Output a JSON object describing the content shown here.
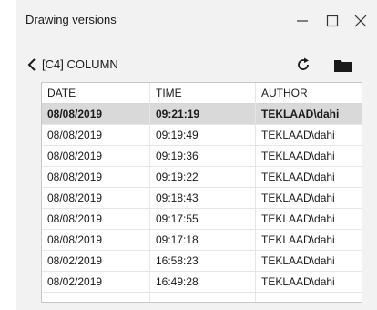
{
  "window": {
    "title": "Drawing versions"
  },
  "toolbar": {
    "object_label": "[C4] COLUMN"
  },
  "table": {
    "columns": [
      "DATE",
      "TIME",
      "AUTHOR"
    ],
    "rows": [
      {
        "date": "08/08/2019",
        "time": "09:21:19",
        "author": "TEKLAAD\\dahi",
        "selected": true
      },
      {
        "date": "08/08/2019",
        "time": "09:19:49",
        "author": "TEKLAAD\\dahi"
      },
      {
        "date": "08/08/2019",
        "time": "09:19:36",
        "author": "TEKLAAD\\dahi"
      },
      {
        "date": "08/08/2019",
        "time": "09:19:22",
        "author": "TEKLAAD\\dahi"
      },
      {
        "date": "08/08/2019",
        "time": "09:18:43",
        "author": "TEKLAAD\\dahi"
      },
      {
        "date": "08/08/2019",
        "time": "09:17:55",
        "author": "TEKLAAD\\dahi"
      },
      {
        "date": "08/08/2019",
        "time": "09:17:18",
        "author": "TEKLAAD\\dahi"
      },
      {
        "date": "08/02/2019",
        "time": "16:58:23",
        "author": "TEKLAAD\\dahi"
      },
      {
        "date": "08/02/2019",
        "time": "16:49:28",
        "author": "TEKLAAD\\dahi"
      }
    ]
  },
  "colors": {
    "window_bg": "#f2f2f2",
    "selected_row": "#d9d9d9",
    "grid_border": "#c8c8c8"
  },
  "icons": [
    "minimize-icon",
    "maximize-icon",
    "close-icon",
    "back-chevron-icon",
    "refresh-icon",
    "folder-icon"
  ]
}
